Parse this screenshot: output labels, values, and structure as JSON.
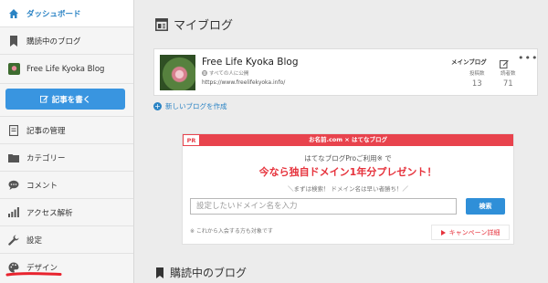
{
  "sidebar": {
    "dashboard": "ダッシュボード",
    "reading": "購読中のブログ",
    "blog_name": "Free Life Kyoka Blog",
    "write_button": "記事を書く",
    "items": [
      {
        "label": "記事の管理",
        "icon": "document-icon"
      },
      {
        "label": "カテゴリー",
        "icon": "folder-icon"
      },
      {
        "label": "コメント",
        "icon": "comment-icon"
      },
      {
        "label": "アクセス解析",
        "icon": "bar-chart-icon"
      },
      {
        "label": "設定",
        "icon": "wrench-icon"
      },
      {
        "label": "デザイン",
        "icon": "palette-icon"
      }
    ],
    "accent_color": "#2a83c4",
    "annotation_color": "#e8232e"
  },
  "main": {
    "title": "マイブログ",
    "blog": {
      "name": "Free Life Kyoka Blog",
      "visibility": "すべての人に公開",
      "url": "https://www.freelifekyoka.info/",
      "main_blog_label": "メインブログ",
      "posts_label": "投稿数",
      "posts": "13",
      "readers_label": "読者数",
      "readers": "71"
    },
    "new_blog": "新しいブログを作成",
    "reading_title": "購読中のブログ"
  },
  "pr": {
    "tag": "PR",
    "brand": "お名前.com × はてなブログ",
    "line1": "はてなブログProご利用※ で",
    "line2": "今なら独自ドメイン1年分プレゼント！",
    "line3": "＼まずは検索！ ドメイン名は早い者勝ち！／",
    "placeholder": "設定したいドメイン名を入力",
    "search_label": "検索",
    "note": "※ これから入会する方も対象です",
    "campaign": "キャンペーン詳細",
    "brand_color": "#e8434d"
  }
}
